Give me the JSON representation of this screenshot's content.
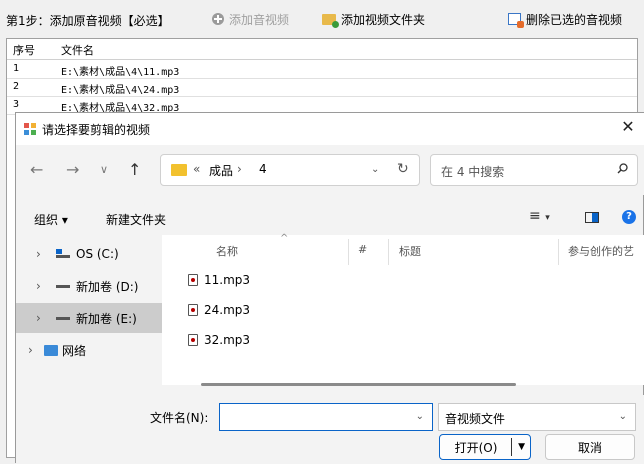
{
  "app": {
    "step_label": "第1步：添加原音视频【必选】",
    "add_av_label": "添加音视频",
    "add_folder_label": "添加视频文件夹",
    "delete_selected_label": "删除已选的音视频",
    "columns": [
      "序号",
      "文件名"
    ],
    "rows": [
      {
        "num": "1",
        "path": "E:\\素材\\成品\\4\\11.mp3"
      },
      {
        "num": "2",
        "path": "E:\\素材\\成品\\4\\24.mp3"
      },
      {
        "num": "3",
        "path": "E:\\素材\\成品\\4\\32.mp3"
      }
    ]
  },
  "dialog": {
    "title": "请选择要剪辑的视频",
    "close_glyph": "✕",
    "nav": {
      "back": "←",
      "forward": "→",
      "recent": "∨",
      "up": "↑"
    },
    "breadcrumb": {
      "prefix": "«",
      "seg1": "成品",
      "sep": "›",
      "seg2": "4"
    },
    "search_placeholder": "在 4 中搜索",
    "commands": {
      "organize": "组织 ▾",
      "new_folder": "新建文件夹"
    },
    "nav_pane": [
      {
        "label": "OS (C:)"
      },
      {
        "label": "新加卷 (D:)"
      },
      {
        "label": "新加卷 (E:)"
      },
      {
        "label": "网络"
      }
    ],
    "columns": {
      "name": "名称",
      "num": "#",
      "title": "标题",
      "artist": "参与创作的艺"
    },
    "files": [
      "11.mp3",
      "24.mp3",
      "32.mp3"
    ],
    "filename_label": "文件名(N):",
    "filename_value": "",
    "filetype_value": "音视频文件",
    "open_label": "打开(O)",
    "cancel_label": "取消"
  },
  "colors": {
    "accent": "#0a64c8",
    "help": "#1a73e8"
  }
}
